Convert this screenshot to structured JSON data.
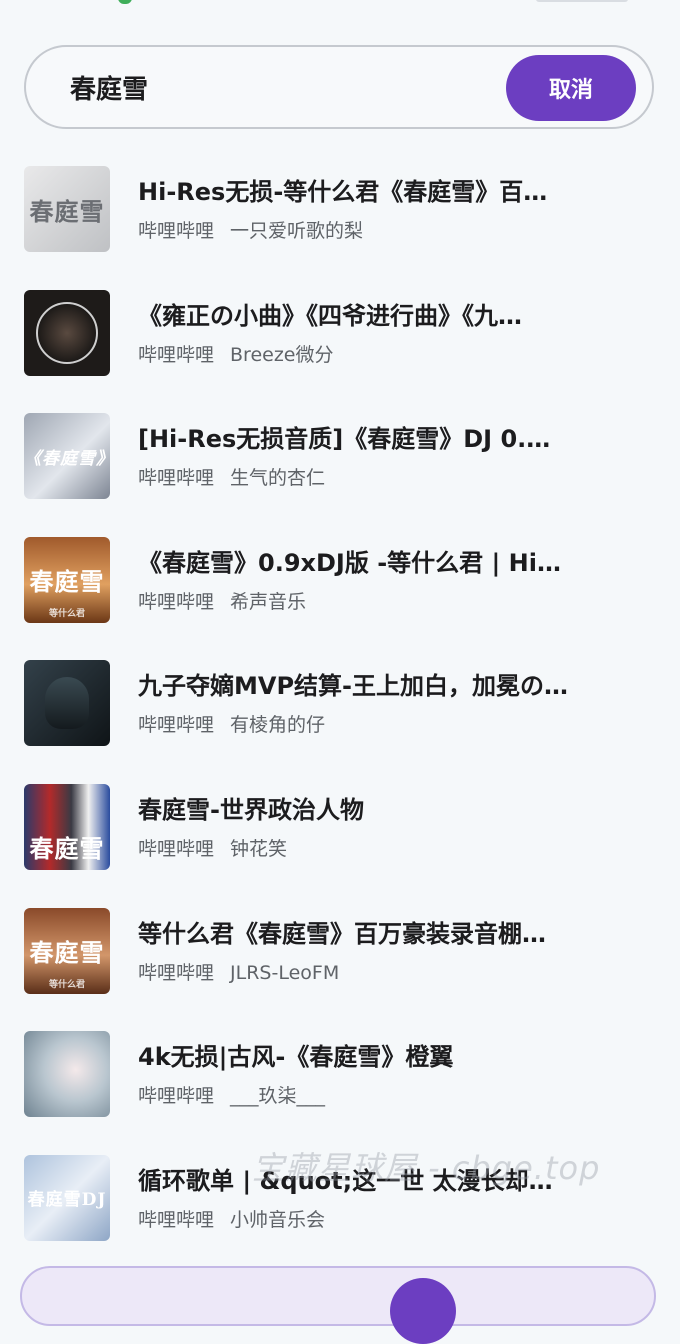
{
  "search": {
    "query": "春庭雪",
    "cancel_label": "取消"
  },
  "results": [
    {
      "title": "Hi-Res无损-等什么君《春庭雪》百…",
      "platform": "哔哩哔哩",
      "uploader": "一只爱听歌的梨",
      "thumb_text": "春庭雪"
    },
    {
      "title": "《雍正の小曲》《四爷进行曲》《九…",
      "platform": "哔哩哔哩",
      "uploader": "Breeze微分"
    },
    {
      "title": "[Hi-Res无损音质]《春庭雪》DJ 0.…",
      "platform": "哔哩哔哩",
      "uploader": "生气的杏仁",
      "thumb_text": "《春庭雪》"
    },
    {
      "title": "《春庭雪》0.9xDJ版 -等什么君 | Hi…",
      "platform": "哔哩哔哩",
      "uploader": "希声音乐",
      "thumb_text": "春庭雪",
      "thumb_sub": "等什么君"
    },
    {
      "title": "九子夺嫡MVP结算-王上加白，加冕の…",
      "platform": "哔哩哔哩",
      "uploader": "有棱角的仔"
    },
    {
      "title": "春庭雪-世界政治人物",
      "platform": "哔哩哔哩",
      "uploader": "钟花笑",
      "thumb_text": "春庭雪"
    },
    {
      "title": "等什么君《春庭雪》百万豪装录音棚…",
      "platform": "哔哩哔哩",
      "uploader": "JLRS-LeoFM",
      "thumb_text": "春庭雪",
      "thumb_sub": "等什么君"
    },
    {
      "title": "4k无损|古风-《春庭雪》橙翼",
      "platform": "哔哩哔哩",
      "uploader": "___玖柒___"
    },
    {
      "title": "循环歌单 | &quot;这一世 太漫长却…",
      "platform": "哔哩哔哩",
      "uploader": "小帅音乐会",
      "thumb_text": "春庭雪DJ"
    }
  ],
  "watermark": "宝藏星球屋 - cbge.top",
  "colors": {
    "accent": "#6c3ec1",
    "background": "#f5f8fa",
    "meta_text": "#5f6368"
  }
}
